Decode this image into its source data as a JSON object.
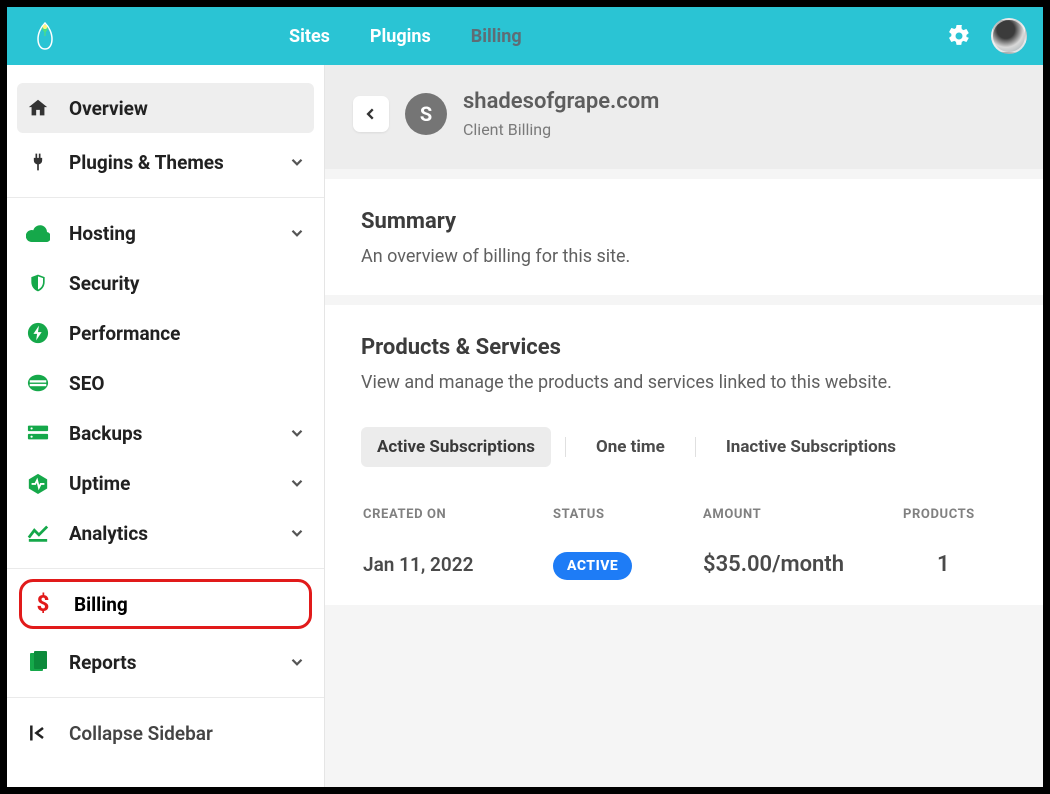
{
  "topbar": {
    "nav": [
      {
        "label": "Sites",
        "active": true
      },
      {
        "label": "Plugins",
        "active": true
      },
      {
        "label": "Billing",
        "active": false
      }
    ]
  },
  "sidebar": {
    "overview": "Overview",
    "plugins_themes": "Plugins & Themes",
    "hosting": "Hosting",
    "security": "Security",
    "performance": "Performance",
    "seo": "SEO",
    "backups": "Backups",
    "uptime": "Uptime",
    "analytics": "Analytics",
    "billing": "Billing",
    "reports": "Reports",
    "collapse": "Collapse Sidebar"
  },
  "site": {
    "name": "shadesofgrape.com",
    "subtitle": "Client Billing",
    "badge": "S"
  },
  "summary": {
    "title": "Summary",
    "desc": "An overview of billing for this site."
  },
  "products": {
    "title": "Products & Services",
    "desc": "View and manage the products and services linked to this website.",
    "filters": {
      "active": "Active Subscriptions",
      "onetime": "One time",
      "inactive": "Inactive Subscriptions"
    },
    "columns": {
      "created": "CREATED ON",
      "status": "STATUS",
      "amount": "AMOUNT",
      "products": "PRODUCTS"
    },
    "rows": [
      {
        "created": "Jan 11, 2022",
        "status": "ACTIVE",
        "amount": "$35.00/month",
        "products": "1"
      }
    ]
  }
}
